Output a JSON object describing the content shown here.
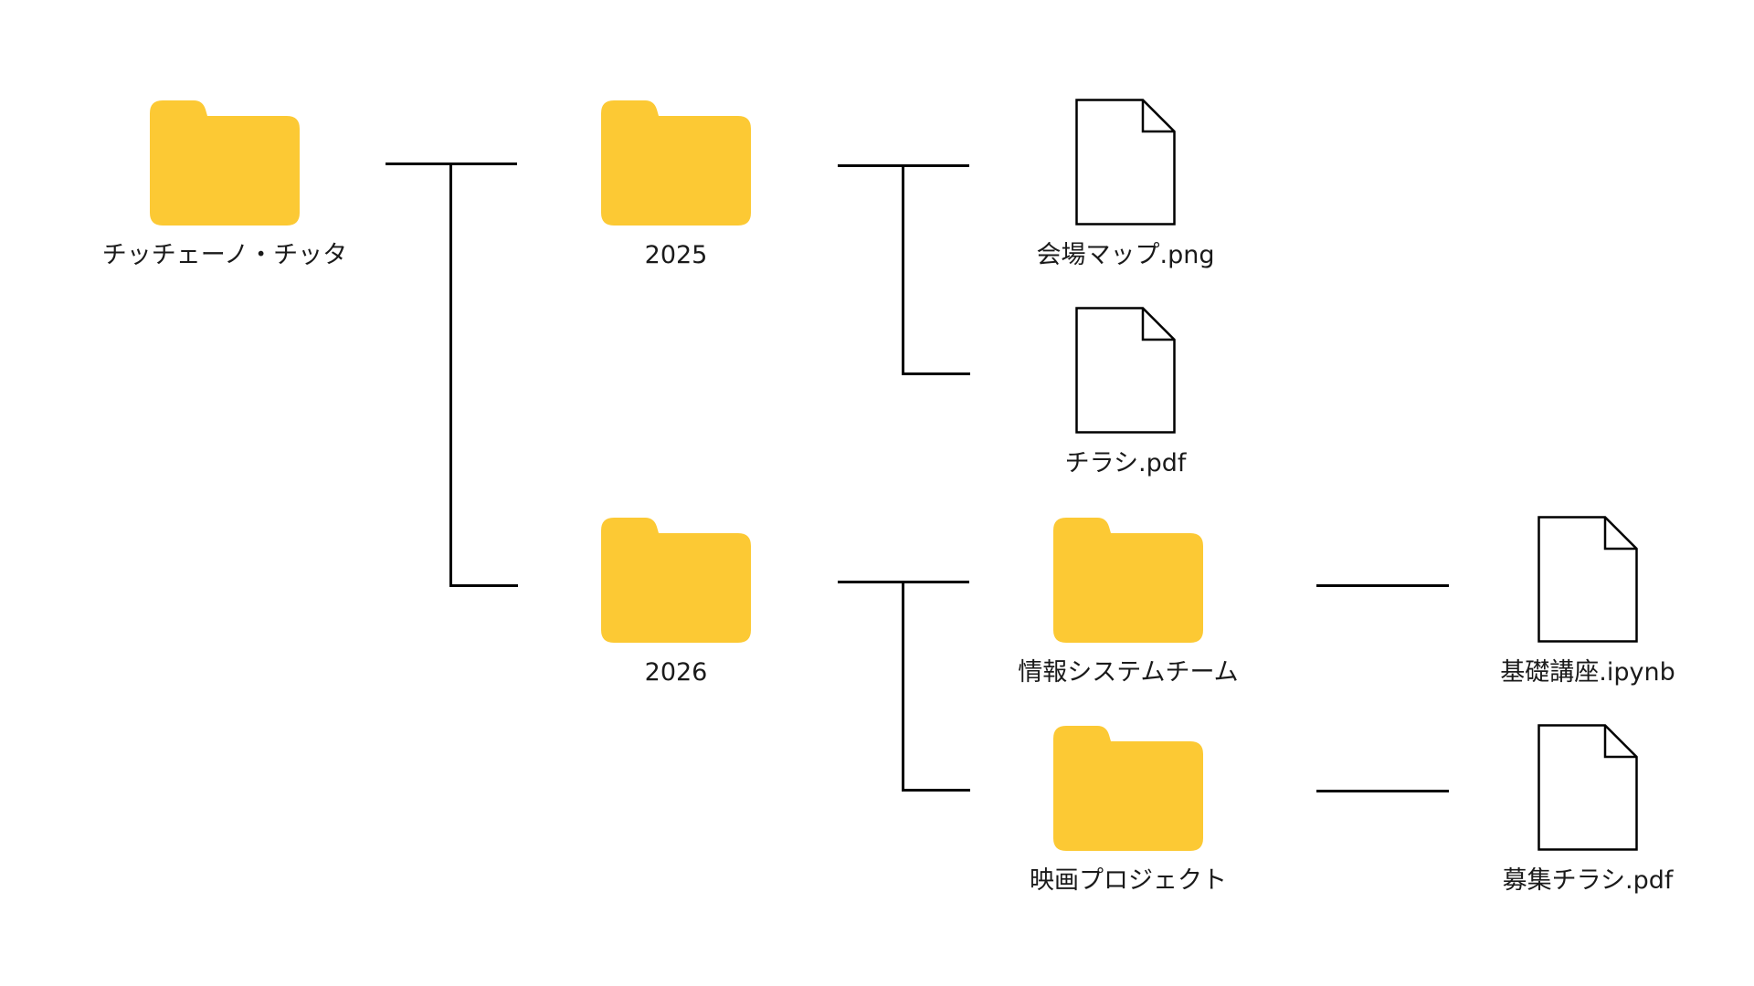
{
  "tree": {
    "root": {
      "label": "チッチェーノ・チッタ",
      "kind": "folder"
    },
    "folder_2025": {
      "label": "2025",
      "kind": "folder"
    },
    "folder_2026": {
      "label": "2026",
      "kind": "folder"
    },
    "file_map": {
      "label": "会場マップ.png",
      "kind": "file"
    },
    "file_flyer": {
      "label": "チラシ.pdf",
      "kind": "file"
    },
    "folder_info_team": {
      "label": "情報システムチーム",
      "kind": "folder"
    },
    "folder_movie": {
      "label": "映画プロジェクト",
      "kind": "folder"
    },
    "file_notebook": {
      "label": "基礎講座.ipynb",
      "kind": "file"
    },
    "file_recruit": {
      "label": "募集チラシ.pdf",
      "kind": "file"
    }
  },
  "colors": {
    "folder": "#FCC934",
    "file_fill": "#FFFFFF",
    "file_stroke": "#000000",
    "connector": "#000000",
    "background": "#FFFFFF"
  },
  "icons": {
    "folder": "folder-icon",
    "file": "file-icon"
  }
}
